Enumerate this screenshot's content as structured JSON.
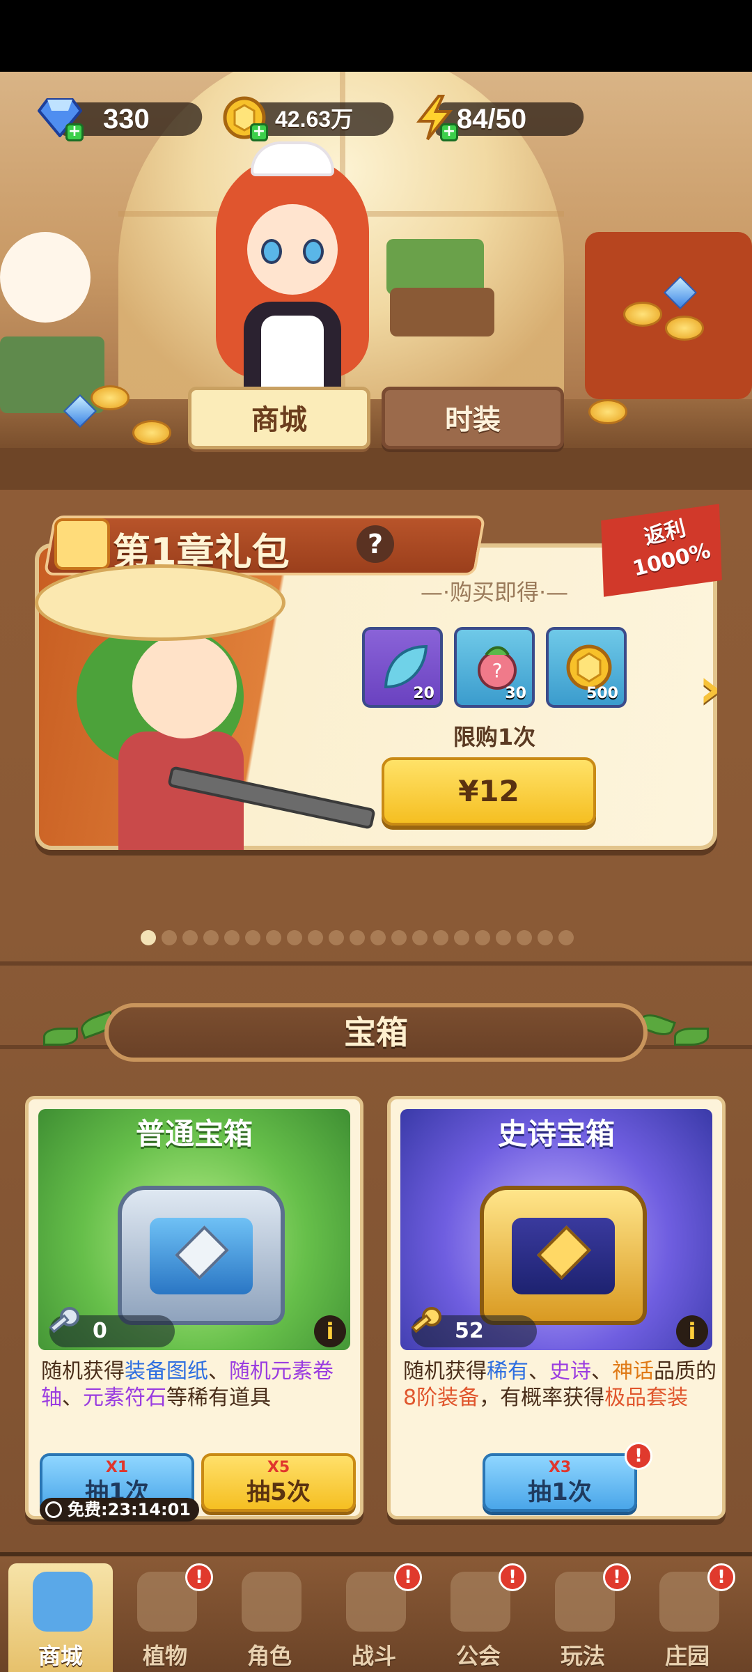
{
  "resources": {
    "gems": "330",
    "coins": "42.63万",
    "energy": "84/50"
  },
  "shop_tabs": {
    "shop": "商城",
    "fashion": "时装"
  },
  "gift_pack": {
    "title": "第1章礼包",
    "help": "?",
    "rebate_line1": "返利",
    "rebate_line2": "1000%",
    "buy_label": "—·购买即得·—",
    "items": [
      {
        "icon": "leaf-icon",
        "qty": "20"
      },
      {
        "icon": "seed-orb-icon",
        "qty": "30"
      },
      {
        "icon": "coin-icon",
        "qty": "500"
      }
    ],
    "limit": "限购1次",
    "price": "¥12",
    "next": "›"
  },
  "carousel": {
    "total": 21,
    "active": 0
  },
  "chests_section": {
    "title": "宝箱"
  },
  "chests": {
    "normal": {
      "name": "普通宝箱",
      "key_count": "0",
      "desc_prefix": "随机获得",
      "desc_h1": "装备图纸",
      "desc_sep1": "、",
      "desc_h2": "随机元素卷轴",
      "desc_sep2": "、",
      "desc_h3": "元素符石",
      "desc_suffix": "等稀有道具",
      "draw1_mult": "X1",
      "draw1_label": "抽1次",
      "draw5_mult": "X5",
      "draw5_label": "抽5次",
      "free_timer": "免费:23:14:01"
    },
    "epic": {
      "name": "史诗宝箱",
      "key_count": "52",
      "desc_prefix": "随机获得",
      "desc_h1": "稀有",
      "desc_sep1": "、",
      "desc_h2": "史诗",
      "desc_sep2": "、",
      "desc_h3": "神话",
      "desc_mid": "品质的",
      "desc_h4": "8阶装备",
      "desc_mid2": "，有概率获得",
      "desc_h5": "极品套装",
      "draw1_mult": "X3",
      "draw1_label": "抽1次",
      "badge": "!"
    }
  },
  "nav": [
    {
      "label": "商城",
      "icon": "shop-icon",
      "active": true,
      "badge": ""
    },
    {
      "label": "植物",
      "icon": "plant-icon",
      "active": false,
      "badge": "!"
    },
    {
      "label": "角色",
      "icon": "character-icon",
      "active": false,
      "badge": ""
    },
    {
      "label": "战斗",
      "icon": "battle-icon",
      "active": false,
      "badge": "!"
    },
    {
      "label": "公会",
      "icon": "guild-icon",
      "active": false,
      "badge": "!"
    },
    {
      "label": "玩法",
      "icon": "gameplay-icon",
      "active": false,
      "badge": "!"
    },
    {
      "label": "庄园",
      "icon": "manor-icon",
      "active": false,
      "badge": "!"
    }
  ]
}
